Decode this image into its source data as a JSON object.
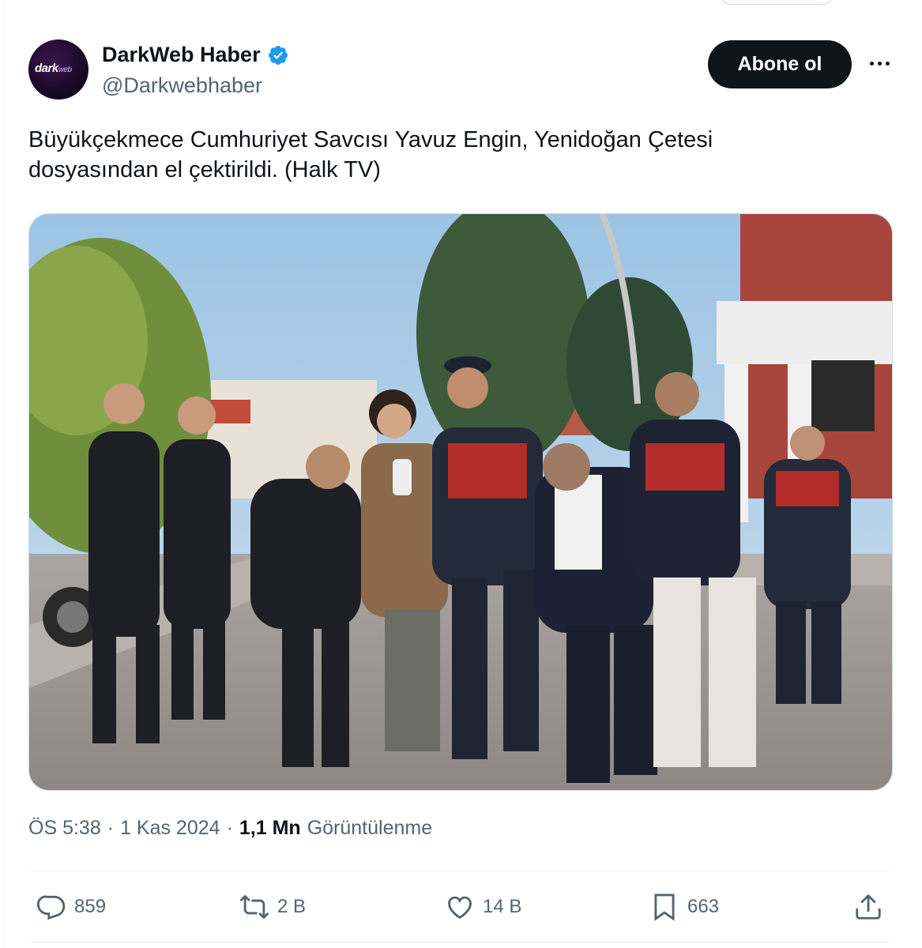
{
  "author": {
    "display_name": "DarkWeb Haber",
    "handle": "@Darkwebhaber",
    "avatar_text": "dark",
    "avatar_subtext": "web"
  },
  "follow_label": "Abone ol",
  "tweet": {
    "line1": "Büyükçekmece Cumhuriyet Savcısı Yavuz Engin, Yenidoğan Çetesi",
    "line2": "dosyasından el çektirildi. (Halk TV)"
  },
  "meta": {
    "time": "ÖS 5:38",
    "sep1": "·",
    "date": "1 Kas 2024",
    "sep2": "·",
    "views": "1,1 Mn",
    "views_label": "Görüntülenme"
  },
  "actions": {
    "replies": "859",
    "reposts": "2 B",
    "likes": "14 B",
    "bookmarks": "663"
  },
  "colors": {
    "text": "#0f1419",
    "secondary": "#536471",
    "verified": "#1d9bf0",
    "button": "#0f1419"
  }
}
